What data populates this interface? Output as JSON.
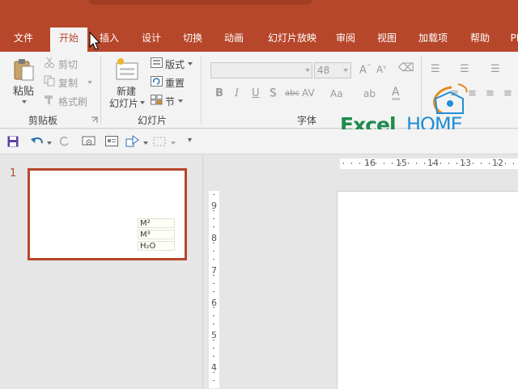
{
  "tabs": [
    "文件",
    "开始",
    "插入",
    "设计",
    "切换",
    "动画",
    "幻灯片放映",
    "审阅",
    "视图",
    "加载项",
    "帮助",
    "PI"
  ],
  "active_tab": "开始",
  "clipboard": {
    "paste": "粘贴",
    "cut": "剪切",
    "copy": "复制",
    "format_painter": "格式刷",
    "group": "剪贴板"
  },
  "slides": {
    "new_slide_line1": "新建",
    "new_slide_line2": "幻灯片",
    "layout": "版式",
    "reset": "重置",
    "section": "节",
    "group": "幻灯片"
  },
  "font": {
    "name": "",
    "size": "48",
    "format_buttons": [
      "B",
      "I",
      "U",
      "S",
      "abc"
    ],
    "group": "字体"
  },
  "logo": {
    "excel": "Excel",
    "home": "HOME"
  },
  "thumbnail": {
    "number": "1",
    "cells": [
      "M²",
      "M³",
      "H₂O"
    ]
  },
  "ruler": {
    "horizontal": [
      "16",
      "15",
      "14",
      "13",
      "12"
    ],
    "vertical": [
      "9",
      "8",
      "7",
      "6",
      "5",
      "4"
    ]
  },
  "colors": {
    "accent": "#b7472a",
    "logo_green": "#1e8b4e",
    "logo_blue": "#1f8fd6",
    "logo_orange": "#e08a1e"
  }
}
